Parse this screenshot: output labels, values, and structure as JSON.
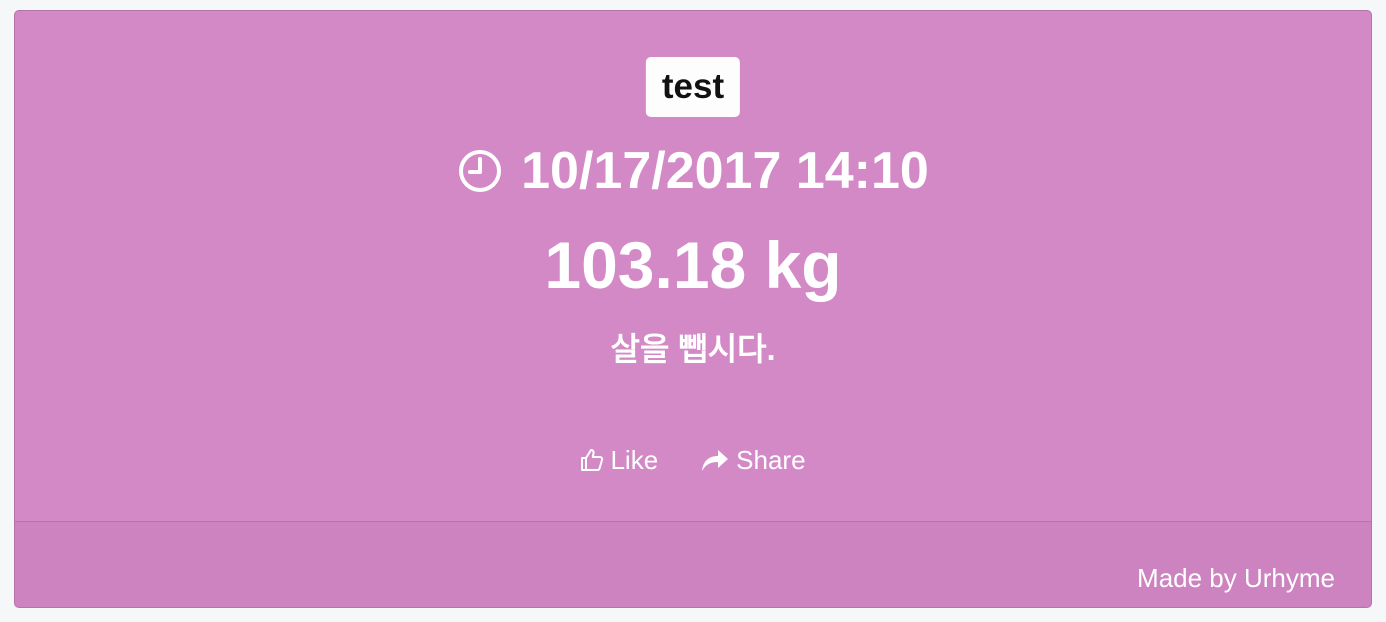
{
  "card": {
    "tag": "test",
    "datetime": "10/17/2017 14:10",
    "weight": "103.18 kg",
    "message": "살을 뺍시다.",
    "actions": {
      "like_label": "Like",
      "share_label": "Share"
    },
    "footer": {
      "credit": "Made by Urhyme"
    }
  },
  "icons": {
    "clock": "clock-icon",
    "like": "thumbs-up-icon",
    "share": "share-arrow-icon"
  },
  "colors": {
    "card_background": "#d489c7",
    "footer_background": "#cc83bf",
    "border": "#b574a8",
    "text": "#ffffff",
    "tag_background": "#fdfdfd",
    "tag_text": "#111111"
  }
}
